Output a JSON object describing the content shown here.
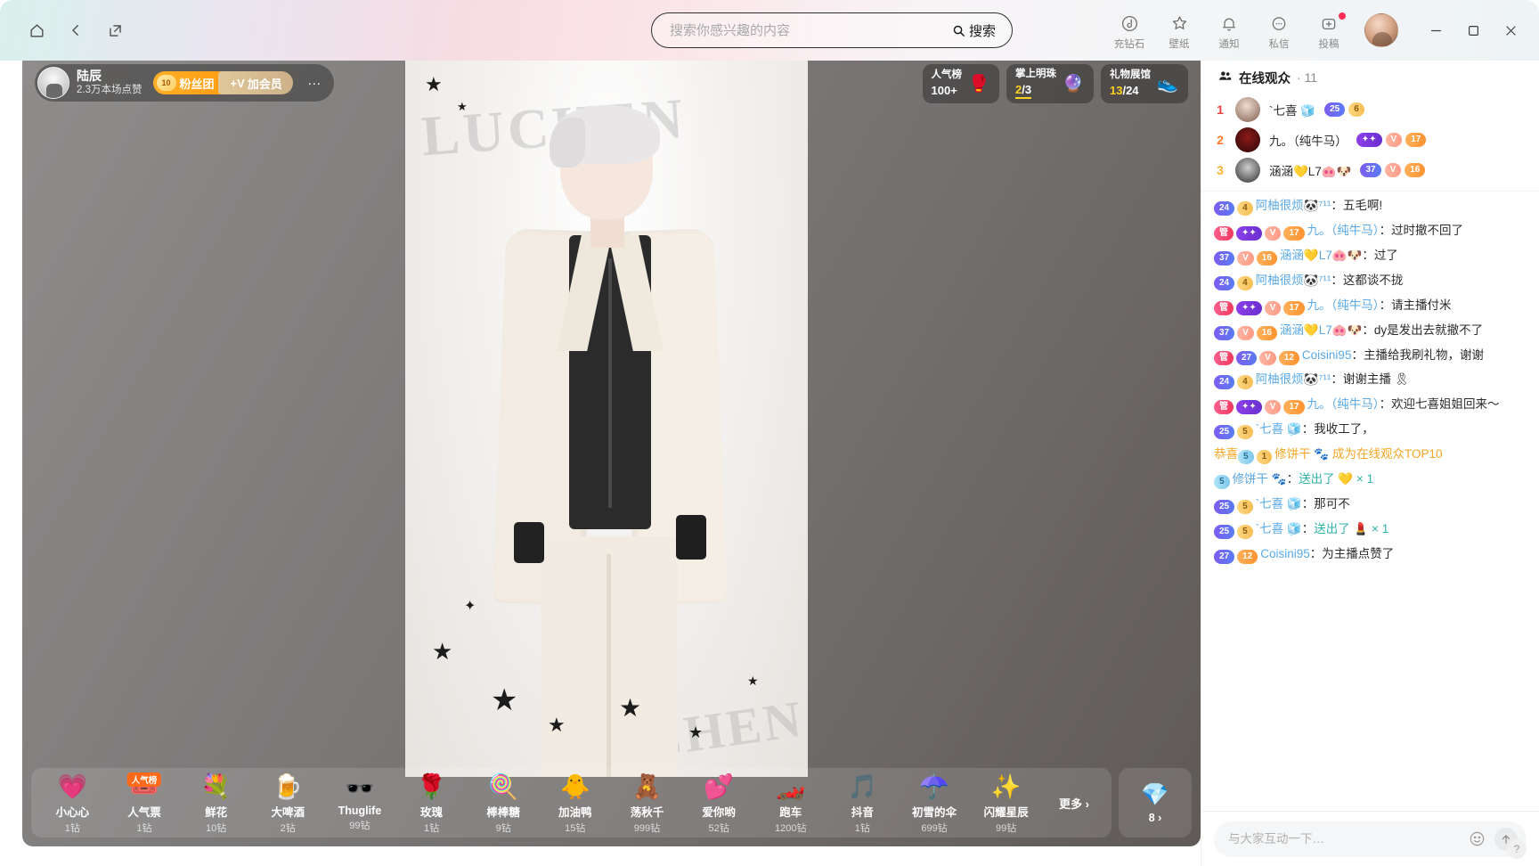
{
  "titlebar": {
    "home_icon": "home-icon",
    "back_icon": "back-chevron-icon",
    "popout_icon": "open-external-icon",
    "search": {
      "placeholder": "搜索你感兴趣的内容",
      "value": "",
      "button_label": "搜索",
      "button_icon": "search-icon"
    },
    "nav": [
      {
        "label": "充钻石",
        "icon": "diamond-recharge-icon",
        "badge": false
      },
      {
        "label": "壁纸",
        "icon": "wallpaper-star-icon",
        "badge": false
      },
      {
        "label": "通知",
        "icon": "bell-icon",
        "badge": false
      },
      {
        "label": "私信",
        "icon": "message-bubble-icon",
        "badge": false
      },
      {
        "label": "投稿",
        "icon": "upload-plus-icon",
        "badge": true
      }
    ],
    "window": {
      "minimize": "minimize-icon",
      "maximize": "maximize-icon",
      "close": "close-icon"
    }
  },
  "stage": {
    "streamer": {
      "name": "陆辰",
      "stats": "2.3万本场点赞",
      "fanclub_level": "10",
      "fanclub_label": "粉丝团",
      "join_member_label": "加会员",
      "more_label": "···"
    },
    "widgets": [
      {
        "title": "人气榜",
        "value": "100+",
        "icon": "🥊",
        "highlight": ""
      },
      {
        "title": "掌上明珠",
        "value": "/3",
        "highlight": "2",
        "icon": "🔮"
      },
      {
        "title": "礼物展馆",
        "value": "/24",
        "highlight": "13",
        "icon": "👟"
      }
    ],
    "poster": {
      "text_top": "LUCHEN",
      "text_bottom": "CHEN"
    }
  },
  "gifts": {
    "items": [
      {
        "name": "小心心",
        "price": "1钻",
        "icon": "💗",
        "tag": ""
      },
      {
        "name": "人气票",
        "price": "1钻",
        "icon": "🎟️",
        "tag": "人气榜"
      },
      {
        "name": "鲜花",
        "price": "10钻",
        "icon": "💐",
        "tag": ""
      },
      {
        "name": "大啤酒",
        "price": "2钻",
        "icon": "🍺",
        "tag": ""
      },
      {
        "name": "Thuglife",
        "price": "99钻",
        "icon": "🕶️",
        "tag": ""
      },
      {
        "name": "玫瑰",
        "price": "1钻",
        "icon": "🌹",
        "tag": ""
      },
      {
        "name": "棒棒糖",
        "price": "9钻",
        "icon": "🍭",
        "tag": ""
      },
      {
        "name": "加油鸭",
        "price": "15钻",
        "icon": "🐥",
        "tag": ""
      },
      {
        "name": "荡秋千",
        "price": "999钻",
        "icon": "🧸",
        "tag": ""
      },
      {
        "name": "爱你哟",
        "price": "52钻",
        "icon": "💕",
        "tag": ""
      },
      {
        "name": "跑车",
        "price": "1200钻",
        "icon": "🏎️",
        "tag": ""
      },
      {
        "name": "抖音",
        "price": "1钻",
        "icon": "🎵",
        "tag": ""
      },
      {
        "name": "初雪的伞",
        "price": "699钻",
        "icon": "☂️",
        "tag": ""
      },
      {
        "name": "闪耀星辰",
        "price": "99钻",
        "icon": "✨",
        "tag": ""
      }
    ],
    "more_label": "更多",
    "more_icon": "chevron-right-icon",
    "pack": {
      "icon": "💎",
      "count": "8",
      "arrow": "chevron-right-icon"
    }
  },
  "panel": {
    "viewers_title": "在线观众",
    "viewers_count": "11",
    "viewers_icon": "people-icon",
    "viewers": [
      {
        "rank": "1",
        "name": "`七喜 🧊",
        "badges": [
          {
            "type": "lvl",
            "text": "25"
          },
          {
            "type": "coin",
            "text": "6"
          }
        ]
      },
      {
        "rank": "2",
        "name": "九。（纯牛马）",
        "badges": [
          {
            "type": "purple",
            "text": "✦✦"
          },
          {
            "type": "fan",
            "text": "V "
          },
          {
            "type": "fan2",
            "text": "17"
          }
        ]
      },
      {
        "rank": "3",
        "name": "涵涵💛L7🐽🐶",
        "badges": [
          {
            "type": "lvl",
            "text": "37"
          },
          {
            "type": "fan",
            "text": "V"
          },
          {
            "type": "fan2",
            "text": "16"
          }
        ]
      }
    ],
    "messages": [
      {
        "badges": [
          {
            "type": "lvl",
            "text": "24"
          },
          {
            "type": "coin",
            "text": "4"
          }
        ],
        "user": "阿柚很烦🐼⁷¹¹",
        "sep": "：",
        "text": "五毛啊!"
      },
      {
        "badges": [
          {
            "type": "admin",
            "text": "管"
          },
          {
            "type": "purple",
            "text": "✦✦"
          },
          {
            "type": "fan",
            "text": "V "
          },
          {
            "type": "fan2",
            "text": "17"
          }
        ],
        "user": "九。（纯牛马）",
        "sep": "：",
        "text": "过时撤不回了"
      },
      {
        "badges": [
          {
            "type": "lvl",
            "text": "37"
          },
          {
            "type": "fan",
            "text": "V"
          },
          {
            "type": "fan2",
            "text": "16"
          }
        ],
        "user": "涵涵💛L7🐽🐶",
        "sep": "：",
        "text": "过了"
      },
      {
        "badges": [
          {
            "type": "lvl",
            "text": "24"
          },
          {
            "type": "coin",
            "text": "4"
          }
        ],
        "user": "阿柚很烦🐼⁷¹¹",
        "sep": "：",
        "text": "这都谈不拢"
      },
      {
        "badges": [
          {
            "type": "admin",
            "text": "管"
          },
          {
            "type": "purple",
            "text": "✦✦"
          },
          {
            "type": "fan",
            "text": "V "
          },
          {
            "type": "fan2",
            "text": "17"
          }
        ],
        "user": "九。（纯牛马）",
        "sep": "：",
        "text": "请主播付米"
      },
      {
        "badges": [
          {
            "type": "lvl",
            "text": "37"
          },
          {
            "type": "fan",
            "text": "V"
          },
          {
            "type": "fan2",
            "text": "16"
          }
        ],
        "user": "涵涵💛L7🐽🐶",
        "sep": "：",
        "text": "dy是发出去就撤不了"
      },
      {
        "badges": [
          {
            "type": "admin",
            "text": "管"
          },
          {
            "type": "lvl",
            "text": "27"
          },
          {
            "type": "fan",
            "text": "V"
          },
          {
            "type": "fan2",
            "text": "12"
          }
        ],
        "user": "Coisini95",
        "sep": "：",
        "text": "主播给我刷礼物，谢谢"
      },
      {
        "badges": [
          {
            "type": "lvl",
            "text": "24"
          },
          {
            "type": "coin",
            "text": "4"
          }
        ],
        "user": "阿柚很烦🐼⁷¹¹",
        "sep": "：",
        "text": "谢谢主播 🎗"
      },
      {
        "badges": [
          {
            "type": "admin",
            "text": "管"
          },
          {
            "type": "purple",
            "text": "✦✦"
          },
          {
            "type": "fan",
            "text": "V "
          },
          {
            "type": "fan2",
            "text": "17"
          }
        ],
        "user": "九。（纯牛马）",
        "sep": "：",
        "text": "欢迎七喜姐姐回来～"
      },
      {
        "badges": [
          {
            "type": "lvl",
            "text": "25"
          },
          {
            "type": "coin",
            "text": "5"
          }
        ],
        "user": "`七喜 🧊",
        "sep": "：",
        "text": "我收工了，"
      },
      {
        "system": true,
        "prefix": "恭喜",
        "badges": [
          {
            "type": "blue",
            "text": "5"
          },
          {
            "type": "coin",
            "text": "1"
          }
        ],
        "user": "修饼干 🐾",
        "sep": " ",
        "text": "成为在线观众TOP10"
      },
      {
        "badges": [
          {
            "type": "blue",
            "text": "5"
          }
        ],
        "user": "修饼干 🐾",
        "sep": "：",
        "gift": true,
        "text": "送出了 💛 × 1"
      },
      {
        "badges": [
          {
            "type": "lvl",
            "text": "25"
          },
          {
            "type": "coin",
            "text": "5"
          }
        ],
        "user": "`七喜 🧊",
        "sep": "：",
        "text": "那可不"
      },
      {
        "badges": [
          {
            "type": "lvl",
            "text": "25"
          },
          {
            "type": "coin",
            "text": "5"
          }
        ],
        "user": "`七喜 🧊",
        "sep": "：",
        "gift": true,
        "text": "送出了 💄 × 1"
      },
      {
        "badges": [
          {
            "type": "lvl",
            "text": "27"
          },
          {
            "type": "fan2",
            "text": "12"
          }
        ],
        "user": "Coisini95",
        "sep": "：",
        "text": "为主播点赞了"
      }
    ],
    "composer": {
      "placeholder": "与大家互动一下…",
      "value": "",
      "emoji_icon": "emoji-icon",
      "send_icon": "send-icon"
    },
    "help_icon": "help-icon"
  }
}
